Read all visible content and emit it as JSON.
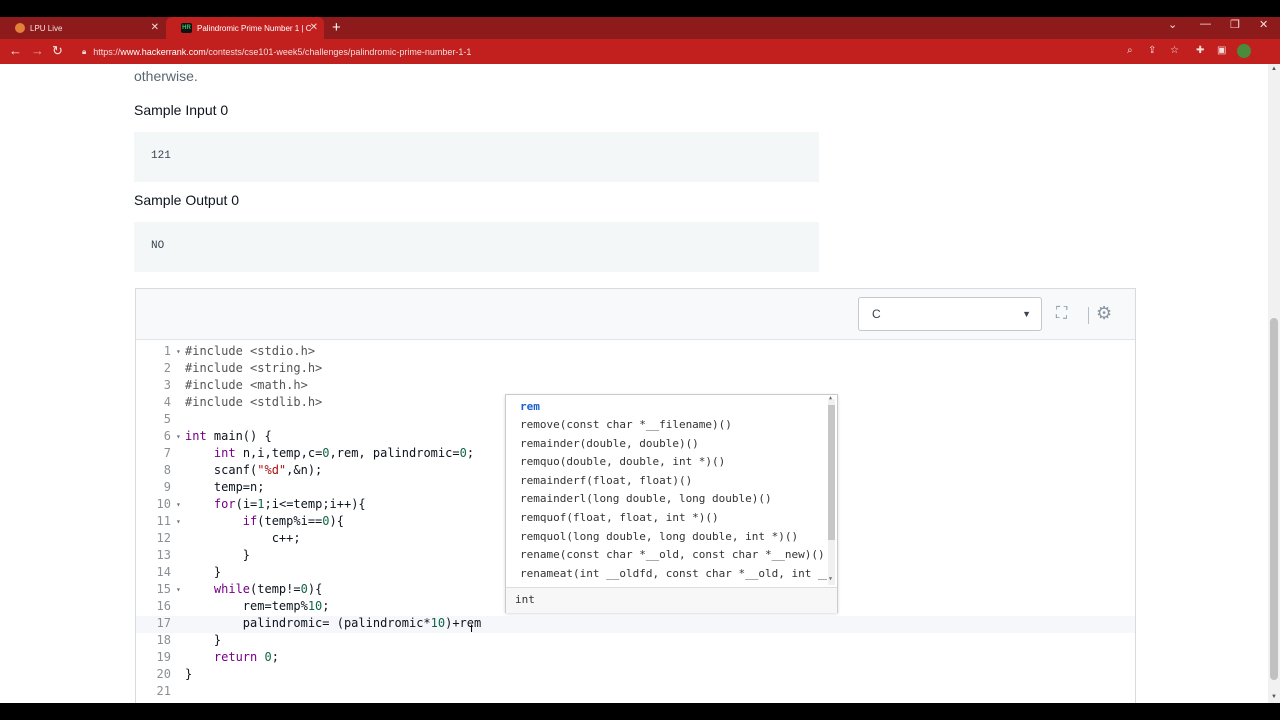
{
  "browser": {
    "tabs": [
      {
        "title": "LPU Live",
        "active": false
      },
      {
        "title": "Palindromic Prime Number 1 | C",
        "active": true
      }
    ],
    "url_prefix": "https://",
    "url_host": "www.hackerrank.com",
    "url_path": "/contests/cse101-week5/challenges/palindromic-prime-number-1-1",
    "favicon_tab2": "HR",
    "colors": {
      "tabstrip": "#8e1b1b",
      "toolbar": "#c21f1f"
    }
  },
  "problem": {
    "tail_text": "otherwise.",
    "sample_input_heading": "Sample Input 0",
    "sample_input": "121",
    "sample_output_heading": "Sample Output 0",
    "sample_output": "NO"
  },
  "editor": {
    "language": "C",
    "line_numbers": [
      "1",
      "2",
      "3",
      "4",
      "5",
      "6",
      "7",
      "8",
      "9",
      "10",
      "11",
      "12",
      "13",
      "14",
      "15",
      "16",
      "17",
      "18",
      "19",
      "20",
      "21"
    ],
    "autocomplete": {
      "items": [
        "rem",
        "remove(const char *__filename)()",
        "remainder(double, double)()",
        "remquo(double, double, int *)()",
        "remainderf(float, float)()",
        "remainderl(long double, long double)()",
        "remquof(float, float, int *)()",
        "remquol(long double, long double, int *)()",
        "rename(const char *__old, const char *__new)()",
        "renameat(int __oldfd, const char *__old, int __r"
      ],
      "selected_index": 0,
      "detail": "int"
    }
  }
}
